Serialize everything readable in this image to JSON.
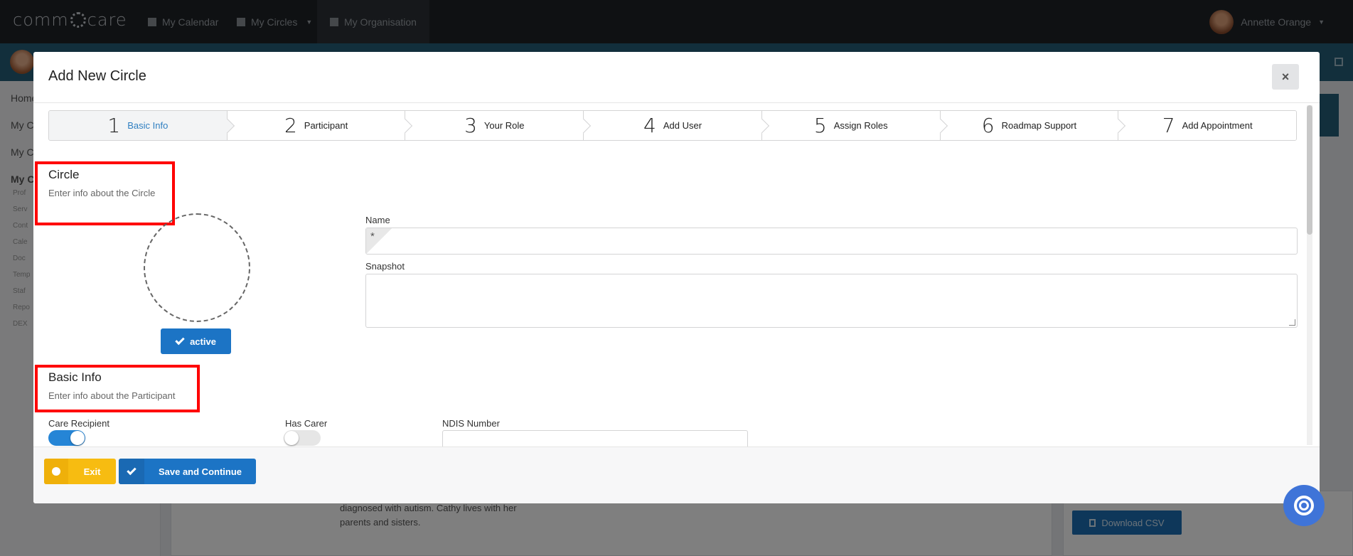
{
  "app": {
    "brand": "comm care",
    "nav": [
      {
        "label": "My Calendar",
        "icon": "calendar-icon"
      },
      {
        "label": "My Circles",
        "icon": "users-icon"
      },
      {
        "label": "My Organisation",
        "icon": "building-icon"
      }
    ],
    "user_name": "Annette Orange"
  },
  "sidebar": {
    "items": [
      "Home",
      "My C",
      "My C",
      "My C"
    ],
    "subitems": [
      "Prof",
      "Serv",
      "Cont",
      "Cale",
      "Doc",
      "Temp",
      "Staf",
      "Repo",
      "DEX"
    ]
  },
  "background": {
    "description_text": "diagnosed with autism. Cathy lives with her parents and sisters.",
    "download_csv": "Download CSV"
  },
  "modal": {
    "title": "Add New Circle",
    "close_label": "×",
    "steps": [
      {
        "num": "1",
        "label": "Basic Info",
        "active": true
      },
      {
        "num": "2",
        "label": "Participant",
        "active": false
      },
      {
        "num": "3",
        "label": "Your Role",
        "active": false
      },
      {
        "num": "4",
        "label": "Add User",
        "active": false
      },
      {
        "num": "5",
        "label": "Assign Roles",
        "active": false
      },
      {
        "num": "6",
        "label": "Roadmap Support",
        "active": false
      },
      {
        "num": "7",
        "label": "Add Appointment",
        "active": false
      }
    ],
    "circle_section": {
      "title": "Circle",
      "subtitle": "Enter info about the Circle"
    },
    "active_button": "active",
    "name_field": {
      "label": "Name",
      "value": "",
      "required_mark": "*"
    },
    "snapshot_field": {
      "label": "Snapshot",
      "value": ""
    },
    "basic_info_section": {
      "title": "Basic Info",
      "subtitle": "Enter info about the Participant"
    },
    "care_recipient": {
      "label": "Care Recipient",
      "on": true
    },
    "has_carer": {
      "label": "Has Carer",
      "on": false
    },
    "ndis_number": {
      "label": "NDIS Number",
      "value": ""
    },
    "footer": {
      "exit": "Exit",
      "save": "Save and Continue"
    }
  },
  "colors": {
    "primary": "#1c74c5",
    "warning": "#f7bc11",
    "highlight": "#ff0000",
    "topbar": "#1f2327",
    "subbar": "#255e79"
  }
}
